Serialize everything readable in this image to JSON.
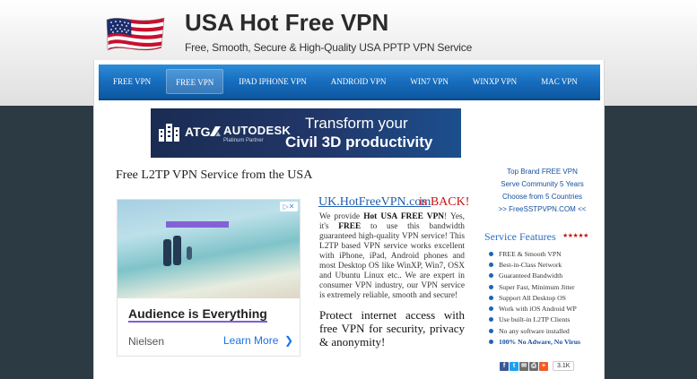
{
  "header": {
    "title": "USA Hot Free VPN",
    "tagline": "Free, Smooth, Secure & High-Quality USA PPTP VPN Service"
  },
  "nav": {
    "items": [
      {
        "label": "FREE VPN",
        "active": false
      },
      {
        "label": "FREE VPN",
        "active": true
      },
      {
        "label": "IPAD IPHONE VPN",
        "active": false
      },
      {
        "label": "ANDROID VPN",
        "active": false
      },
      {
        "label": "WIN7 VPN",
        "active": false
      },
      {
        "label": "WINXP VPN",
        "active": false
      },
      {
        "label": "MAC VPN",
        "active": false
      }
    ]
  },
  "banner": {
    "atg": "ATG",
    "brand": "AUTODESK",
    "brand_sub": "Platinum Partner",
    "line1": "Transform your",
    "line2": "Civil 3D productivity"
  },
  "main": {
    "heading": "Free L2TP VPN Service from the USA",
    "promo_link": "UK.HotFreeVPN.com",
    "promo_suffix": "is BACK!",
    "para_start": "We provide ",
    "para_bold1": "Hot USA FREE VPN",
    "para_mid1": "! Yes, it's ",
    "para_bold2": "FREE",
    "para_rest": " to use this bandwidth guaranteed high-quality VPN service! This L2TP based VPN service works excellent with iPhone, iPad,  Android phones and most Desktop OS like WinXP, Win7, OSX and Ubuntu Linux etc.. We are expert in consumer VPN industry, our VPN service is extremely reliable, smooth and secure!",
    "protect": "Protect internet access with free VPN for security, privacy & anonymity!"
  },
  "ad": {
    "badge": "▷✕",
    "title": "Audience is Everything",
    "brand": "Nielsen",
    "cta": "Learn More",
    "cta_icon": "chevron-right-icon"
  },
  "sidebar": {
    "promo_lines": [
      "Top Brand FREE VPN",
      "Serve Community 5 Years",
      "Choose from 5 Countries",
      ">> FreeSSTPVPN.COM <<"
    ],
    "features_title": "Service Features",
    "stars": "★★★★★",
    "features": [
      "FREE & Smooth VPN",
      "Best-in-Class Network",
      "Guaranteed Bandwidth",
      "Super Fast, Minimum Jitter",
      "Support All Desktop OS",
      "Work with iOS Android WP",
      "Use built-in L2TP Clients",
      "No any software installed",
      "100% No Adware, No Virus"
    ],
    "share_count": "3.1K",
    "share_buttons": [
      {
        "icon": "facebook-icon",
        "glyph": "f",
        "color": "#3b5998"
      },
      {
        "icon": "twitter-icon",
        "glyph": "t",
        "color": "#1da1f2"
      },
      {
        "icon": "email-icon",
        "glyph": "✉",
        "color": "#6f6f6f"
      },
      {
        "icon": "print-icon",
        "glyph": "⎙",
        "color": "#6f6f6f"
      },
      {
        "icon": "plus-icon",
        "glyph": "+",
        "color": "#f65a24"
      }
    ]
  },
  "colors": {
    "nav_blue": "#176dbe",
    "link_blue": "#1f5fae",
    "accent_red": "#d01010",
    "dark_band": "#2c3a44"
  }
}
